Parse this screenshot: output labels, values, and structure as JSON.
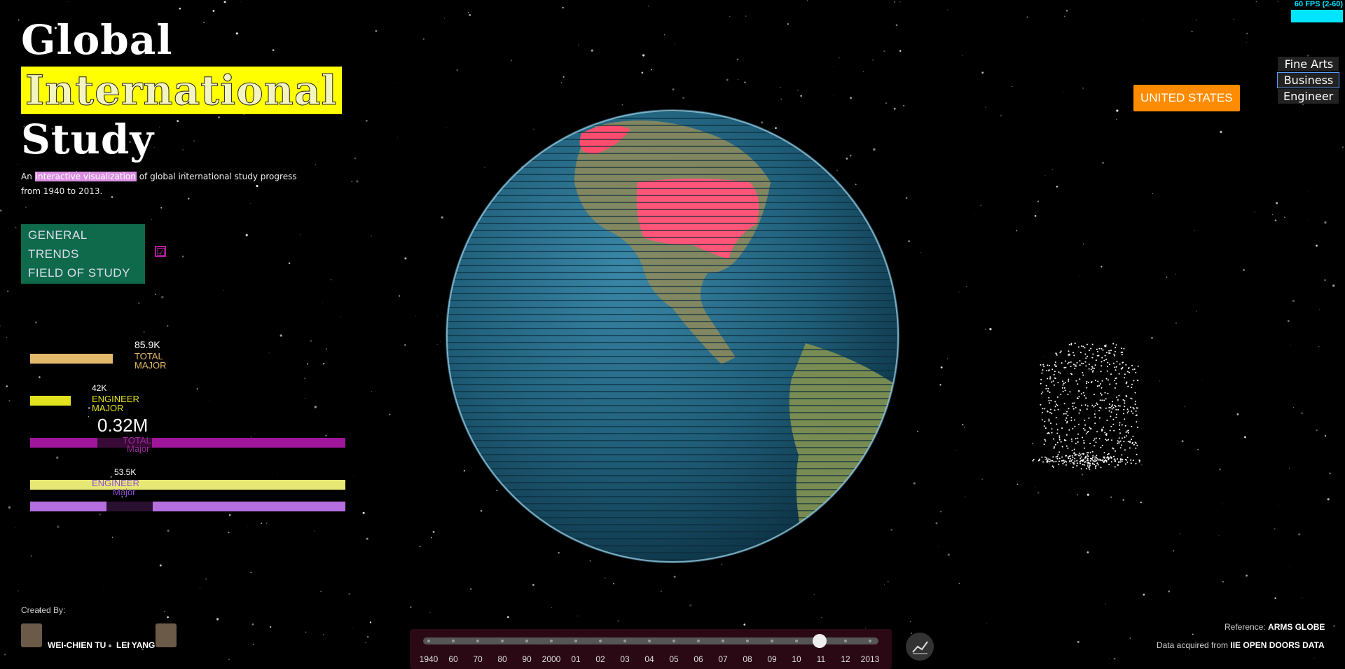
{
  "title": {
    "line1": "Global",
    "line2": "International",
    "line3": "Study"
  },
  "subtitle": {
    "pre": "An",
    "highlight": "interactive visualization",
    "post": "of global international study progress",
    "line2": "from 1940 to 2013."
  },
  "trends": {
    "general": "GENERAL TRENDS",
    "field": "FIELD OF STUDY",
    "checkbox_mark": "☑"
  },
  "country_button": "UNITED STATES",
  "fps": "60 FPS (2-60)",
  "fields": [
    {
      "label": "Fine Arts"
    },
    {
      "label": "Business",
      "selected": true
    },
    {
      "label": "Engineer"
    }
  ],
  "stats": {
    "country_total": {
      "value": "85.9K",
      "label1": "TOTAL",
      "label2": "MAJOR",
      "fraction": 1.0
    },
    "country_engineer": {
      "value": "42K",
      "label1": "ENGINEER",
      "label2": "MAJOR",
      "fraction": 0.49
    },
    "global_total": {
      "value": "0.32M",
      "label1": "TOTAL",
      "label2": "Major"
    },
    "global_engineer": {
      "value": "53.5K",
      "label1": "ENGINEER",
      "label2": "Major"
    }
  },
  "credits": {
    "created_by": "Created By:",
    "author1": "WEI-CHIEN TU",
    "author2": "LEI YANG"
  },
  "reference": {
    "label": "Reference:",
    "value": "ARMS GLOBE"
  },
  "source": {
    "label": "Data acquired from",
    "value": "IIE OPEN DOORS DATA"
  },
  "timeline": {
    "labels": [
      "1940",
      "60",
      "70",
      "80",
      "90",
      "2000",
      "01",
      "02",
      "03",
      "04",
      "05",
      "06",
      "07",
      "08",
      "09",
      "10",
      "11",
      "12",
      "2013"
    ],
    "selected": "11"
  },
  "colors": {
    "accent": "#ff8c00",
    "highlight": "#ffff00",
    "trend": "#0e6a4a",
    "total_bar": "#e2b86a",
    "engineer_bar": "#e2e21e",
    "global_total": "#a0169a",
    "global_engineer": "#b56fe0"
  },
  "icons": {
    "chart": "line-chart-icon"
  }
}
